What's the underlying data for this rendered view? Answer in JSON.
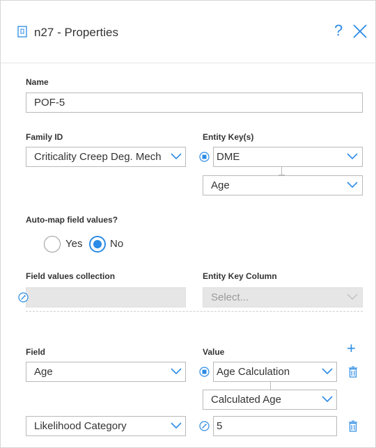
{
  "header": {
    "title": "n27 - Properties",
    "help_label": "?"
  },
  "name": {
    "label": "Name",
    "value": "POF-5"
  },
  "family_id": {
    "label": "Family ID",
    "value": "Criticality Creep Deg. Mech"
  },
  "entity_keys": {
    "label": "Entity Key(s)",
    "items": [
      "DME",
      "Age"
    ]
  },
  "auto_map": {
    "label": "Auto-map field values?",
    "options": [
      "Yes",
      "No"
    ],
    "selected": "No"
  },
  "field_values_collection": {
    "label": "Field values collection",
    "value": ""
  },
  "entity_key_column": {
    "label": "Entity Key Column",
    "placeholder": "Select..."
  },
  "mappings": {
    "field_label": "Field",
    "value_label": "Value",
    "add_label": "+",
    "rows": [
      {
        "field": "Age",
        "value": "Age Calculation",
        "value_sub": "Calculated Age"
      },
      {
        "field": "Likelihood Category",
        "value": "5"
      }
    ]
  },
  "colors": {
    "accent": "#2b8be6",
    "border": "#b9b9b9",
    "disabled_bg": "#e6e6e6"
  }
}
